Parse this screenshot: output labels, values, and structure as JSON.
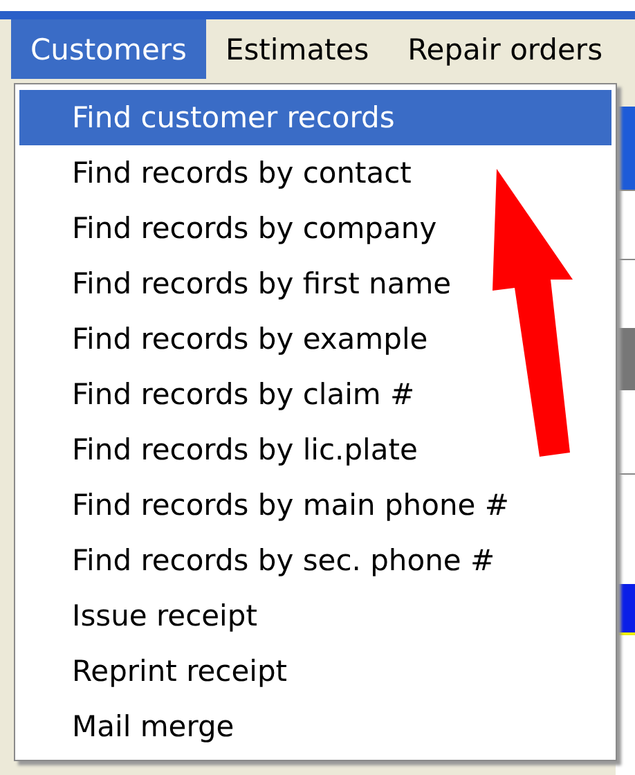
{
  "menu_bar": [
    {
      "label": "Customers",
      "selected": true
    },
    {
      "label": "Estimates",
      "selected": false
    },
    {
      "label": "Repair orders",
      "selected": false
    }
  ],
  "dropdown": [
    {
      "label": "Find customer records",
      "selected": true
    },
    {
      "label": "Find records by contact",
      "selected": false
    },
    {
      "label": "Find records by company",
      "selected": false
    },
    {
      "label": "Find records by first name",
      "selected": false
    },
    {
      "label": "Find records by example",
      "selected": false
    },
    {
      "label": "Find records by claim #",
      "selected": false
    },
    {
      "label": "Find records by lic.plate",
      "selected": false
    },
    {
      "label": "Find records by main phone #",
      "selected": false
    },
    {
      "label": "Find records by sec. phone #",
      "selected": false
    },
    {
      "label": "Issue receipt",
      "selected": false
    },
    {
      "label": "Reprint receipt",
      "selected": false
    },
    {
      "label": "Mail merge",
      "selected": false
    }
  ]
}
